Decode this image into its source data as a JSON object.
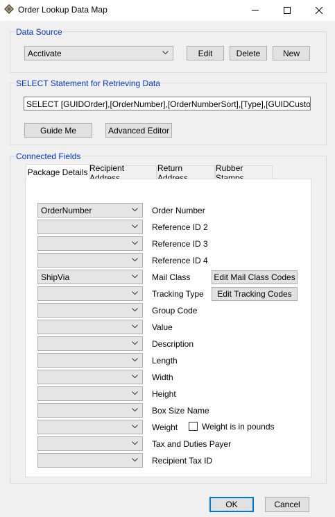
{
  "window": {
    "title": "Order Lookup Data Map",
    "minimize_symbol": "—",
    "maximize_symbol": "☐",
    "close_symbol": "✕"
  },
  "data_source": {
    "group_label": "Data Source",
    "selected": "Acctivate",
    "edit_label": "Edit",
    "delete_label": "Delete",
    "new_label": "New"
  },
  "select_statement": {
    "group_label": "SELECT Statement for Retrieving Data",
    "value": "SELECT [GUIDOrder],[OrderNumber],[OrderNumberSort],[Type],[GUIDCustomerType],",
    "guide_me_label": "Guide Me",
    "advanced_editor_label": "Advanced Editor"
  },
  "connected_fields": {
    "group_label": "Connected Fields",
    "tabs": [
      {
        "label": "Package Details",
        "active": true
      },
      {
        "label": "Recipient Address",
        "active": false
      },
      {
        "label": "Return Address",
        "active": false
      },
      {
        "label": "Rubber Stamps",
        "active": false
      }
    ],
    "rows": [
      {
        "value": "OrderNumber",
        "label": "Order Number"
      },
      {
        "value": "",
        "label": "Reference ID 2"
      },
      {
        "value": "",
        "label": "Reference ID 3"
      },
      {
        "value": "",
        "label": "Reference ID 4"
      },
      {
        "value": "ShipVia",
        "label": "Mail Class"
      },
      {
        "value": "",
        "label": "Tracking Type"
      },
      {
        "value": "",
        "label": "Group Code"
      },
      {
        "value": "",
        "label": "Value"
      },
      {
        "value": "",
        "label": "Description"
      },
      {
        "value": "",
        "label": "Length"
      },
      {
        "value": "",
        "label": "Width"
      },
      {
        "value": "",
        "label": "Height"
      },
      {
        "value": "",
        "label": "Box Size Name"
      },
      {
        "value": "",
        "label": "Weight"
      },
      {
        "value": "",
        "label": "Tax and Duties Payer"
      },
      {
        "value": "",
        "label": "Recipient Tax ID"
      }
    ],
    "edit_mail_class_label": "Edit Mail Class Codes",
    "edit_tracking_label": "Edit Tracking Codes",
    "weight_in_pounds_label": "Weight is in pounds",
    "weight_in_pounds_checked": false
  },
  "footer": {
    "ok_label": "OK",
    "cancel_label": "Cancel"
  },
  "icons": {
    "app": "map-icon",
    "dropdown": "chevron-down-icon"
  }
}
